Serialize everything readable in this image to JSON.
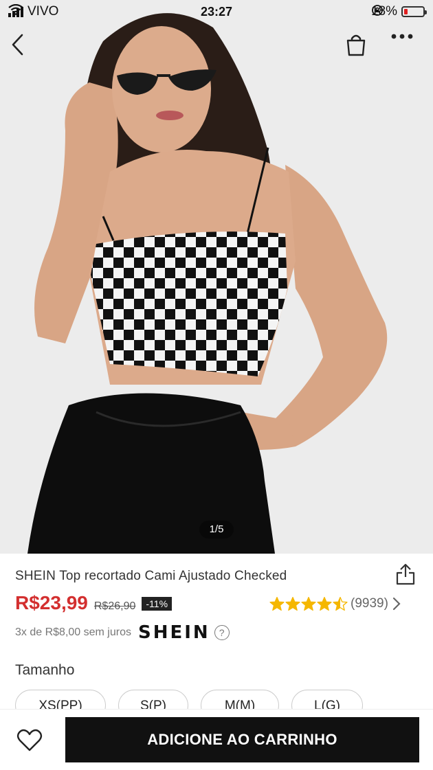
{
  "status_bar": {
    "carrier": "VIVO",
    "time": "23:27",
    "battery": "18%",
    "battery_level": 0.18,
    "battery_color": "#e02020"
  },
  "nav": {
    "back_icon": "chevron-left-icon",
    "bag_icon": "shopping-bag-icon",
    "more_icon": "more-horizontal-icon"
  },
  "gallery": {
    "indicator": "1/5"
  },
  "product": {
    "title": "SHEIN Top recortado Cami Ajustado Checked",
    "price": "R$23,99",
    "old_price": "R$26,90",
    "discount": "-11%",
    "rating": 4.5,
    "review_count": "(9939)",
    "installments": "3x de R$8,00 sem juros",
    "brand": "SHEIN",
    "price_color": "#d32f2f",
    "star_color": "#f5b700"
  },
  "sizes": {
    "label": "Tamanho",
    "options": [
      "XS(PP)",
      "S(P)",
      "M(M)",
      "L(G)"
    ]
  },
  "actions": {
    "add_to_cart": "ADICIONE AO CARRINHO"
  }
}
